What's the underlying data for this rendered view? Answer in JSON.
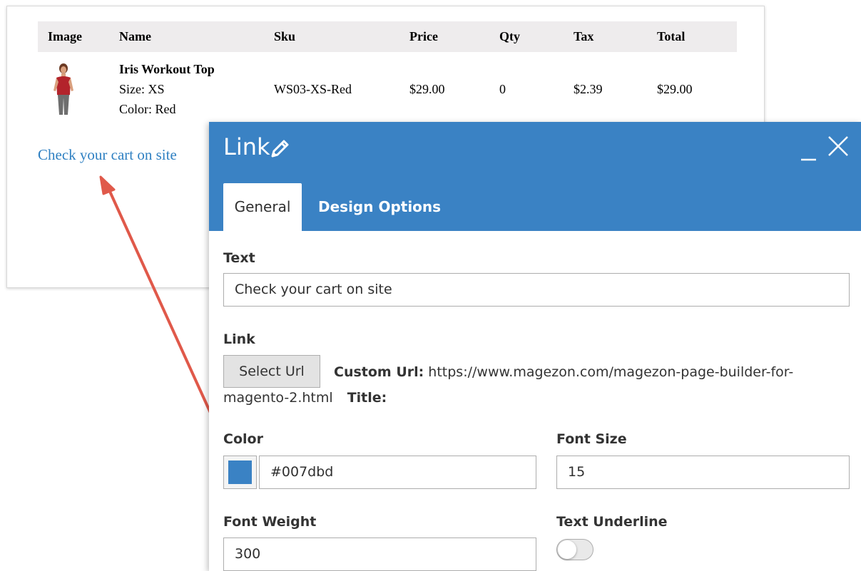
{
  "email": {
    "columns": [
      "Image",
      "Name",
      "Sku",
      "Price",
      "Qty",
      "Tax",
      "Total"
    ],
    "row": {
      "name": "Iris Workout Top",
      "size": "Size: XS",
      "color": "Color: Red",
      "sku": "WS03-XS-Red",
      "price": "$29.00",
      "qty": "0",
      "tax": "$2.39",
      "total": "$29.00"
    },
    "cart_link": "Check your cart on site"
  },
  "modal": {
    "title": "Link",
    "tabs": {
      "general": "General",
      "design": "Design Options"
    },
    "text_label": "Text",
    "text_value": "Check your cart on site",
    "link_label": "Link",
    "select_url_button": "Select Url",
    "custom_url_label": "Custom Url:",
    "custom_url_value_line1": "https://www.magezon.com/magezon-page-builder-for-",
    "custom_url_value_line2": "magento-2.html",
    "title_label": "Title:",
    "color_label": "Color",
    "color_value": "#007dbd",
    "font_size_label": "Font Size",
    "font_size_value": "15",
    "font_weight_label": "Font Weight",
    "font_weight_value": "300",
    "text_underline_label": "Text Underline",
    "text_underline_on": false
  },
  "colors": {
    "header_blue": "#3a82c4",
    "link_blue": "#2f80c2",
    "arrow_red": "#e0594a"
  },
  "icons": [
    "pencil-icon",
    "minimize-icon",
    "close-icon",
    "product-image",
    "arrow"
  ]
}
